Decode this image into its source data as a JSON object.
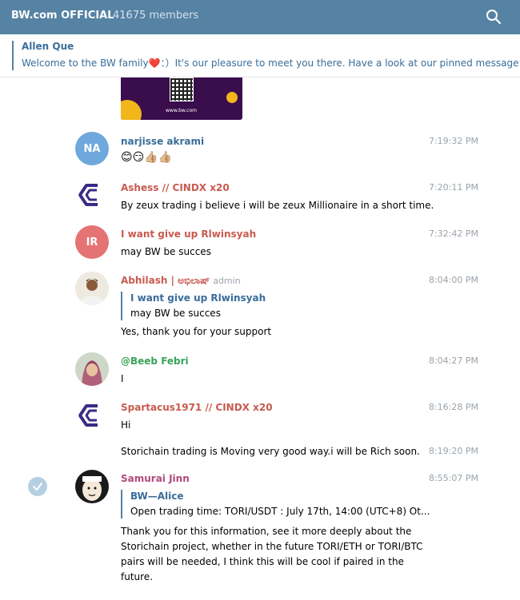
{
  "header": {
    "title": "BW.com OFFICIAL",
    "members": "41675 members"
  },
  "pinned": {
    "author": "Allen Que",
    "text_before": "Welcome to the BW family",
    "text_after": "：）It's our pleasure to meet you there. Have a look at our pinned message b..."
  },
  "image_preview": {
    "url_text": "www.bw.com"
  },
  "messages": [
    {
      "initials": "NA",
      "avatar_color": "#6fa8dc",
      "name": "narjisse akrami",
      "time": "7:19:32 PM",
      "text": "😊😏👍🏼👍🏼"
    },
    {
      "name": "Ashess // CINDX x20",
      "time": "7:20:11 PM",
      "text": "By zeux trading i believe i will be zeux Millionaire in a short time."
    },
    {
      "initials": "IR",
      "avatar_color": "#e57373",
      "name": "I want give up Rlwinsyah",
      "time": "7:32:42 PM",
      "text": "may BW be succes"
    },
    {
      "name": "Abhilash | ಅಭಿಲಾಷ್",
      "badge": "admin",
      "time": "8:04:00 PM",
      "reply": {
        "name": "I want give up Rlwinsyah",
        "text": "may BW be succes"
      },
      "text": "Yes, thank you for your support"
    },
    {
      "name": "@Beeb Febri",
      "time": "8:04:27 PM",
      "text": "I"
    },
    {
      "name": "Spartacus1971 // CINDX x20",
      "time": "8:16:28 PM",
      "text": "Hi"
    },
    {
      "time": "8:19:20 PM",
      "text": "Storichain trading  is Moving very good way.i will be Rich soon."
    },
    {
      "name": "Samurai Jinn",
      "time": "8:55:07 PM",
      "reply": {
        "name": "BW—Alice",
        "text": "Open trading time: TORI/USDT : July 17th, 14:00 (UTC+8) Ot..."
      },
      "text_lines": [
        "Thank you for this information, see it more deeply about the",
        "Storichain project, whether in the future TORI/ETH or TORI/BTC",
        "pairs will be needed, I think this will be cool if paired in the",
        "future."
      ]
    }
  ]
}
